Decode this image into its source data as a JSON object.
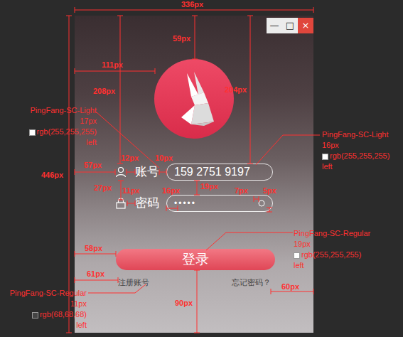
{
  "window": {
    "controls": [
      {
        "glyph": "—",
        "kind": "minimize"
      },
      {
        "glyph": "□",
        "kind": "maximize"
      },
      {
        "glyph": "×",
        "kind": "close"
      }
    ]
  },
  "account": {
    "label": "账号",
    "value": "159 2751 9197"
  },
  "password": {
    "label": "密码",
    "value": "•••••"
  },
  "login_button": "登录",
  "links": [
    "注册账号",
    "忘记密码？"
  ],
  "annotations": {
    "dimensions": [
      {
        "label": "336px"
      },
      {
        "label": "59px"
      },
      {
        "label": "111px"
      },
      {
        "label": "208px"
      },
      {
        "label": "204px"
      },
      {
        "label": "446px"
      },
      {
        "label": "12px"
      },
      {
        "label": "10px"
      },
      {
        "label": "57px"
      },
      {
        "label": "27px"
      },
      {
        "label": "11px"
      },
      {
        "label": "19px"
      },
      {
        "label": "16px"
      },
      {
        "label": "7px"
      },
      {
        "label": "5px"
      },
      {
        "label": "58px"
      },
      {
        "label": "61px"
      },
      {
        "label": "60px"
      },
      {
        "label": "90px"
      }
    ],
    "specs": [
      {
        "font": "PingFang-SC-Light",
        "size": "17px",
        "color": "rgb(255,255,255)",
        "align": "left"
      },
      {
        "font": "PingFang-SC-Light",
        "size": "16px",
        "color": "rgb(255,255,255)",
        "align": "left"
      },
      {
        "font": "PingFang-SC-Regular",
        "size": "19px",
        "color": "rgb(255,255,255)",
        "align": "left"
      },
      {
        "font": "PingFang-SC-Regular",
        "size": "11px",
        "color": "rgb(68,68,68)",
        "align": "left"
      }
    ]
  }
}
